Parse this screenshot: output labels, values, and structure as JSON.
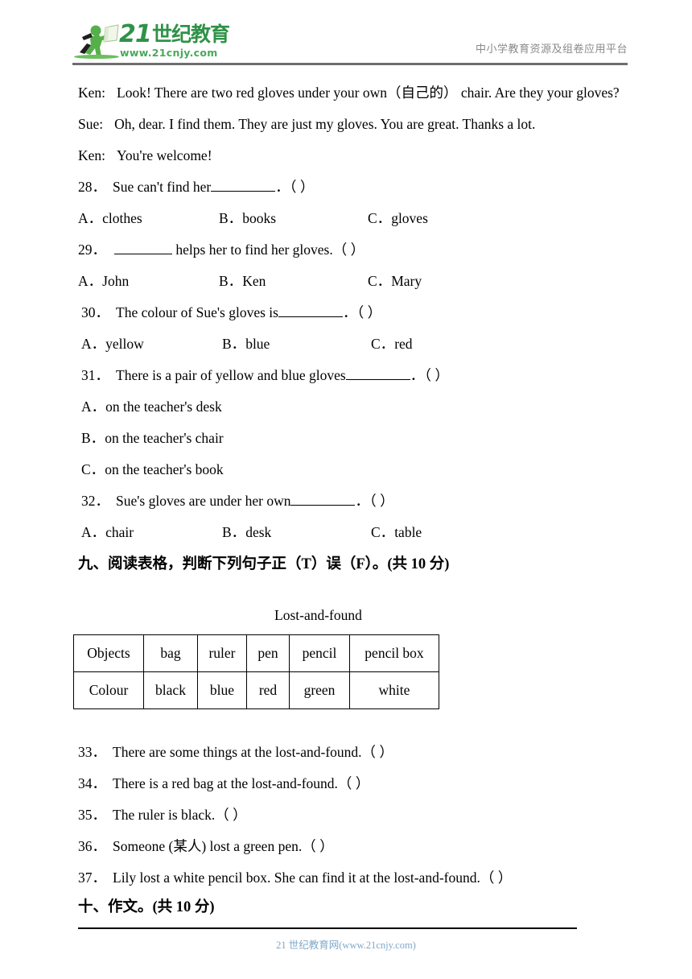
{
  "header": {
    "logo": {
      "icon_name": "running-person-with-flag-logo",
      "number_text": "21",
      "cn_text": "世纪教育",
      "url_text": "www.21cnjy.com",
      "brand_color": "#2f9248"
    },
    "right_text": "中小学教育资源及组卷应用平台"
  },
  "dialogue": [
    {
      "speaker": "Ken:",
      "text": "Look! There are two red gloves under your own（自己的） chair. Are they your gloves?"
    },
    {
      "speaker": "Sue:",
      "text": "Oh, dear. I find them. They are just my gloves. You are great. Thanks a lot."
    },
    {
      "speaker": "Ken:",
      "text": "You're welcome!"
    }
  ],
  "questions": [
    {
      "number": "28．",
      "stem_before": "Sue can't find her",
      "stem_after": "．（     ）",
      "options": [
        {
          "label": "A．",
          "text": "clothes"
        },
        {
          "label": "B．",
          "text": "books"
        },
        {
          "label": "C．",
          "text": "gloves"
        }
      ]
    },
    {
      "number": "29．",
      "stem_before": "",
      "stem_mid": " helps her to find her gloves.（    ）",
      "options": [
        {
          "label": "A．",
          "text": "John"
        },
        {
          "label": "B．",
          "text": "Ken"
        },
        {
          "label": "C．",
          "text": "Mary"
        }
      ]
    },
    {
      "number": "30．",
      "stem_before": "The colour of Sue's gloves is",
      "stem_after": "．（    ）",
      "options": [
        {
          "label": "A．",
          "text": "yellow"
        },
        {
          "label": "B．",
          "text": "blue"
        },
        {
          "label": "C．",
          "text": "red"
        }
      ]
    },
    {
      "number": "31．",
      "stem_before": "There is a pair of yellow and blue gloves",
      "stem_after": "．（     ）",
      "options": [
        {
          "label": "A．",
          "text": "on the teacher's desk"
        },
        {
          "label": "B．",
          "text": "on the teacher's chair"
        },
        {
          "label": "C．",
          "text": "on the teacher's book"
        }
      ]
    },
    {
      "number": "32．",
      "stem_before": "Sue's gloves are under her own",
      "stem_after": "．（     ）",
      "options": [
        {
          "label": "A．",
          "text": "chair"
        },
        {
          "label": "B．",
          "text": "desk"
        },
        {
          "label": "C．",
          "text": "table"
        }
      ]
    }
  ],
  "section_nine": {
    "heading": "九、阅读表格，判断下列句子正（T）误（F）。(共 10 分)"
  },
  "table": {
    "title": "Lost-and-found",
    "rows": [
      {
        "header": "Objects",
        "cells": [
          "bag",
          "ruler",
          "pen",
          "pencil",
          "pencil box"
        ]
      },
      {
        "header": "Colour",
        "cells": [
          "black",
          "blue",
          "red",
          "green",
          "white"
        ]
      }
    ]
  },
  "true_false": [
    {
      "number": "33．",
      "text": "There are some things at the lost-and-found.（        ）"
    },
    {
      "number": "34．",
      "text": "There is a red bag at the lost-and-found.（        ）"
    },
    {
      "number": "35．",
      "text": "The ruler is black.（        ）"
    },
    {
      "number": "36．",
      "text": "Someone (某人) lost a green pen.（        ）"
    },
    {
      "number": "37．",
      "text": "Lily lost a white pencil box. She can find it at the lost-and-found.（        ）"
    }
  ],
  "section_ten": {
    "heading": "十、作文。(共 10 分)"
  },
  "footer": {
    "link_text": "21 世纪教育网(www.21cnjy.com)",
    "link_color": "#7fa8c9"
  }
}
